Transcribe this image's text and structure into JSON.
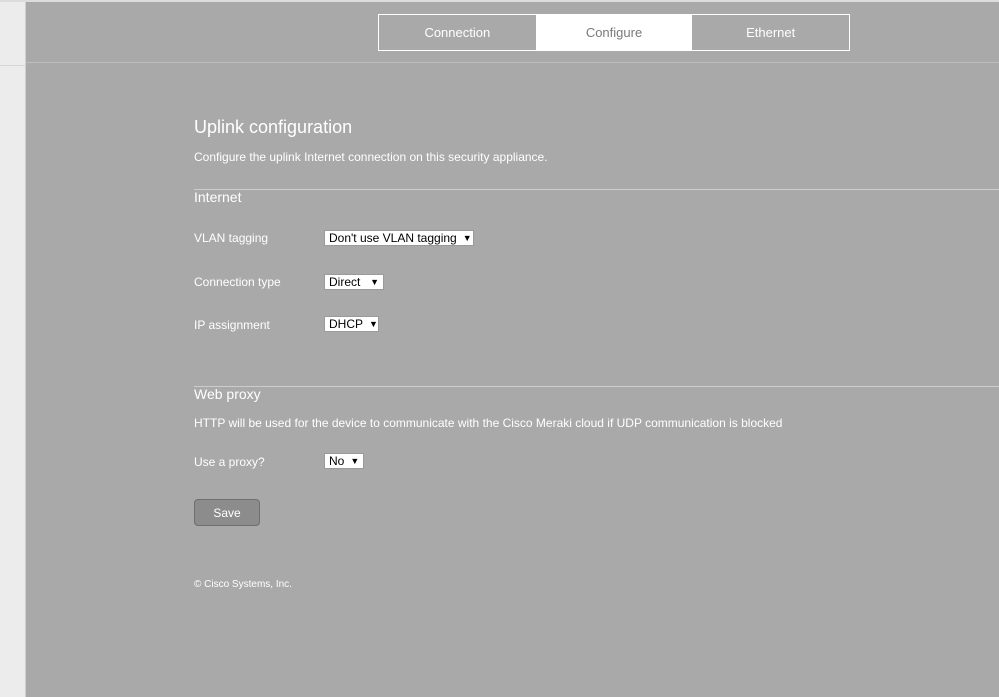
{
  "tabs": [
    {
      "label": "Connection",
      "active": false
    },
    {
      "label": "Configure",
      "active": true
    },
    {
      "label": "Ethernet",
      "active": false
    }
  ],
  "page": {
    "title": "Uplink configuration",
    "subtitle": "Configure the uplink Internet connection on this security appliance."
  },
  "internet": {
    "heading": "Internet",
    "vlan_label": "VLAN tagging",
    "vlan_value": "Don't use VLAN tagging",
    "conn_type_label": "Connection type",
    "conn_type_value": "Direct",
    "ip_label": "IP assignment",
    "ip_value": "DHCP"
  },
  "proxy": {
    "heading": "Web proxy",
    "note": "HTTP will be used for the device to communicate with the Cisco Meraki cloud if UDP communication is blocked",
    "use_proxy_label": "Use a proxy?",
    "use_proxy_value": "No"
  },
  "actions": {
    "save_label": "Save"
  },
  "footer": {
    "copyright": "© Cisco Systems, Inc."
  },
  "icons": {
    "dropdown": "caret-down-icon"
  },
  "colors": {
    "background": "#a9a9a9",
    "tab_active_bg": "#ffffff",
    "button_bg": "#8c8c8c"
  }
}
